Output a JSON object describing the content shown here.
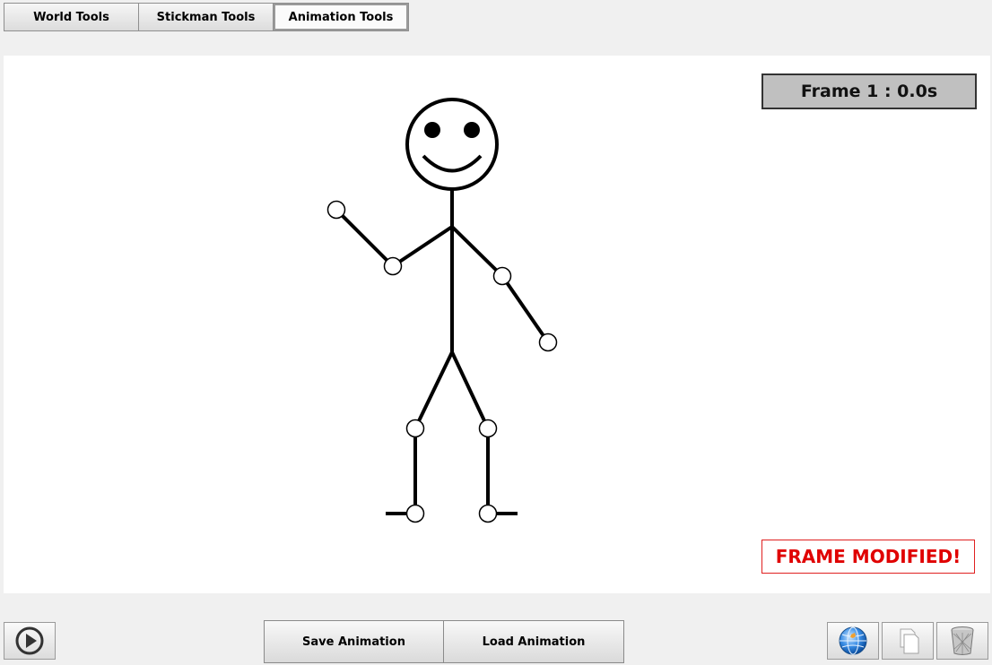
{
  "tabs": [
    {
      "label": "World Tools",
      "active": false
    },
    {
      "label": "Stickman Tools",
      "active": false
    },
    {
      "label": "Animation Tools",
      "active": true
    }
  ],
  "canvas": {
    "frame_label": "Frame 1 : 0.0s",
    "status_label": "FRAME MODIFIED!",
    "background": "#ffffff"
  },
  "bottom_bar": {
    "play_icon": "play-circle-icon",
    "save_label": "Save Animation",
    "load_label": "Load Animation",
    "right_icons": [
      "globe-icon",
      "copy-pages-icon",
      "trash-bin-icon"
    ]
  },
  "colors": {
    "status_red": "#e00000",
    "frame_label_bg": "#c0c0c0",
    "stickman": "#000000"
  }
}
